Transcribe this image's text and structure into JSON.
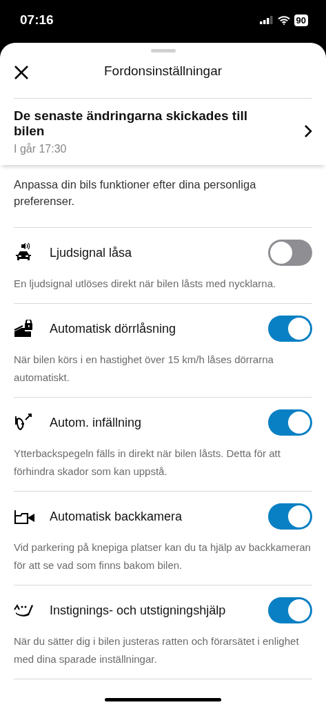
{
  "status_bar": {
    "time": "07:16",
    "battery": "90"
  },
  "header": {
    "title": "Fordonsinställningar"
  },
  "sync_banner": {
    "title": "De senaste ändringarna skickades till bilen",
    "time": "I går 17:30"
  },
  "intro": "Anpassa din bils funktioner efter dina personliga preferenser.",
  "settings": [
    {
      "label": "Ljudsignal låsa",
      "description": "En ljudsignal utlöses direkt när bilen låsts med nycklarna.",
      "on": false
    },
    {
      "label": "Automatisk dörrlåsning",
      "description": "När bilen körs i en hastighet över 15 km/h låses dörrarna automatiskt.",
      "on": true
    },
    {
      "label": "Autom. infällning",
      "description": "Ytterbackspegeln fälls in direkt när bilen låsts. Detta för att förhindra skador som kan uppstå.",
      "on": true
    },
    {
      "label": "Automatisk backkamera",
      "description": "Vid parkering på knepiga platser kan du ta hjälp av backkameran för att se vad som finns bakom bilen.",
      "on": true
    },
    {
      "label": "Instignings- och utstigningshjälp",
      "description": "När du sätter dig i bilen justeras ratten och förarsätet i enlighet med dina sparade inställningar.",
      "on": true
    }
  ]
}
